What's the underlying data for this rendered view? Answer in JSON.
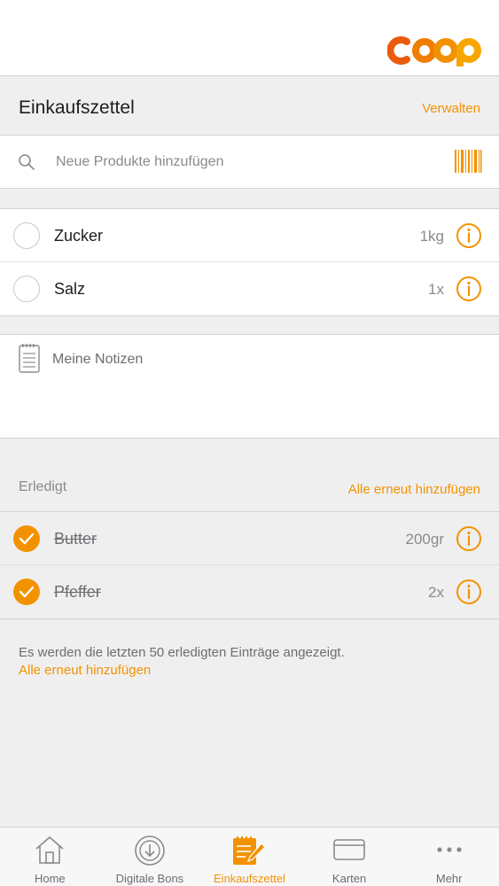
{
  "brand": {
    "logo_text": "coop",
    "accent_color": "#f39200"
  },
  "header": {
    "title": "Einkaufszettel",
    "manage_label": "Verwalten"
  },
  "search": {
    "placeholder": "Neue Produkte hinzufügen",
    "icon": "search-icon",
    "scan_icon": "barcode-icon"
  },
  "items": [
    {
      "name": "Zucker",
      "quantity": "1kg"
    },
    {
      "name": "Salz",
      "quantity": "1x"
    }
  ],
  "notes": {
    "label": "Meine Notizen",
    "icon": "notepad-icon"
  },
  "done": {
    "label": "Erledigt",
    "readd_label": "Alle erneut hinzufügen",
    "items": [
      {
        "name": "Butter",
        "quantity": "200gr"
      },
      {
        "name": "Pfeffer",
        "quantity": "2x"
      }
    ],
    "footnote": "Es werden die letzten 50 erledigten Einträge angezeigt.",
    "footnote_link": "Alle erneut hinzufügen"
  },
  "tabs": [
    {
      "label": "Home",
      "icon": "home-icon",
      "active": false
    },
    {
      "label": "Digitale Bons",
      "icon": "receipt-icon",
      "active": false
    },
    {
      "label": "Einkaufszettel",
      "icon": "shopping-list-icon",
      "active": true
    },
    {
      "label": "Karten",
      "icon": "card-icon",
      "active": false
    },
    {
      "label": "Mehr",
      "icon": "more-icon",
      "active": false
    }
  ]
}
